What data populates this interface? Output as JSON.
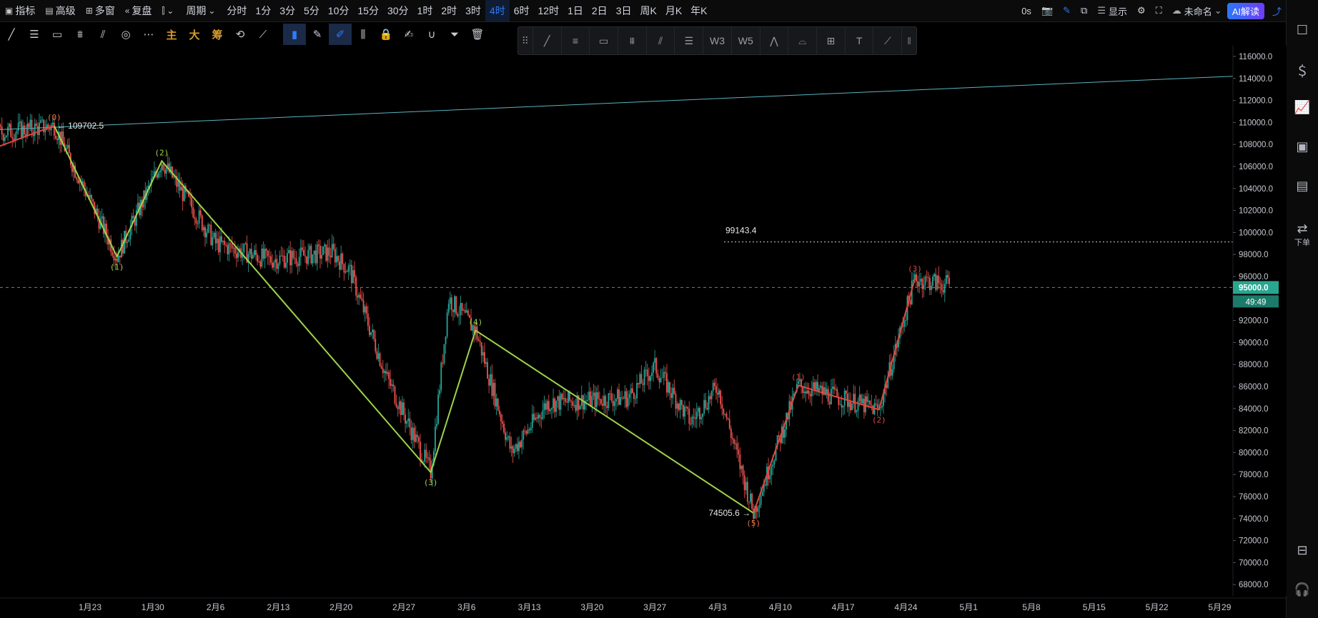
{
  "toolbar": {
    "indicator": "指标",
    "advanced": "高级",
    "multi_window": "多窗",
    "replay": "复盘",
    "period": "周期",
    "timeframes": [
      "分时",
      "1分",
      "3分",
      "5分",
      "10分",
      "15分",
      "30分",
      "1时",
      "2时",
      "3时",
      "4时",
      "6时",
      "12时",
      "1日",
      "2日",
      "3日",
      "周K",
      "月K",
      "年K"
    ],
    "active_timeframe": "4时"
  },
  "topright": {
    "latency": "0s",
    "display": "显示",
    "layout_name": "未命名",
    "ai_button": "AI解读"
  },
  "toolbar2": {
    "cn_tools": [
      "主",
      "大",
      "筹"
    ]
  },
  "rightbar": {
    "order_label": "下单"
  },
  "chart_data": {
    "type": "candlestick",
    "y_axis_ticks": [
      "116000.0",
      "114000.0",
      "112000.0",
      "110000.0",
      "108000.0",
      "106000.0",
      "104000.0",
      "102000.0",
      "100000.0",
      "98000.0",
      "96000.0",
      "94000.0",
      "92000.0",
      "90000.0",
      "88000.0",
      "86000.0",
      "84000.0",
      "82000.0",
      "80000.0",
      "78000.0",
      "76000.0",
      "74000.0",
      "72000.0",
      "70000.0",
      "68000.0"
    ],
    "y_range": [
      67000,
      117000
    ],
    "x_axis_ticks": [
      "1月23",
      "1月30",
      "2月6",
      "2月13",
      "2月20",
      "2月27",
      "3月6",
      "3月13",
      "3月20",
      "3月27",
      "4月3",
      "4月10",
      "4月17",
      "4月24",
      "5月1",
      "5月8",
      "5月15",
      "5月22",
      "5月29"
    ],
    "current_price": "95000.0",
    "countdown": "49:49",
    "annotations": {
      "high_label": "109702.5",
      "low_label": "74505.6",
      "level_label": "99143.4"
    },
    "green_wave": {
      "labels": [
        "(1)",
        "(2)",
        "(3)",
        "(4)"
      ],
      "points": [
        {
          "date": "01-19",
          "price": 109702.5
        },
        {
          "date": "01-26",
          "price": 97800
        },
        {
          "date": "01-31",
          "price": 106500
        },
        {
          "date": "03-02",
          "price": 78200
        },
        {
          "date": "03-07",
          "price": 91100
        },
        {
          "date": "04-07",
          "price": 74505.6
        }
      ]
    },
    "red_wave": {
      "start_label": "(0)",
      "end_label": "(5)",
      "labels": [
        "(1)",
        "(2)",
        "(3)"
      ],
      "points": [
        {
          "date": "04-07",
          "price": 74505.6
        },
        {
          "date": "04-12",
          "price": 86100
        },
        {
          "date": "04-21",
          "price": 83900
        },
        {
          "date": "04-25",
          "price": 95800
        }
      ],
      "lead_in": [
        {
          "date": "01-08",
          "price": 108500
        },
        {
          "date": "01-19",
          "price": 109702.5
        }
      ]
    },
    "trend_line": {
      "from": {
        "date": "01-08",
        "price": 109500
      },
      "to": {
        "date": "06-02",
        "price": 114200
      }
    },
    "candle_colors": {
      "up": "#26a69a",
      "down": "#ef5350",
      "wick_up": "#1e8c7e",
      "wick_down": "#c8433f"
    },
    "line_colors": {
      "green": "#9ed34a",
      "red": "#e0483f",
      "trend": "#5ab4c0"
    }
  }
}
